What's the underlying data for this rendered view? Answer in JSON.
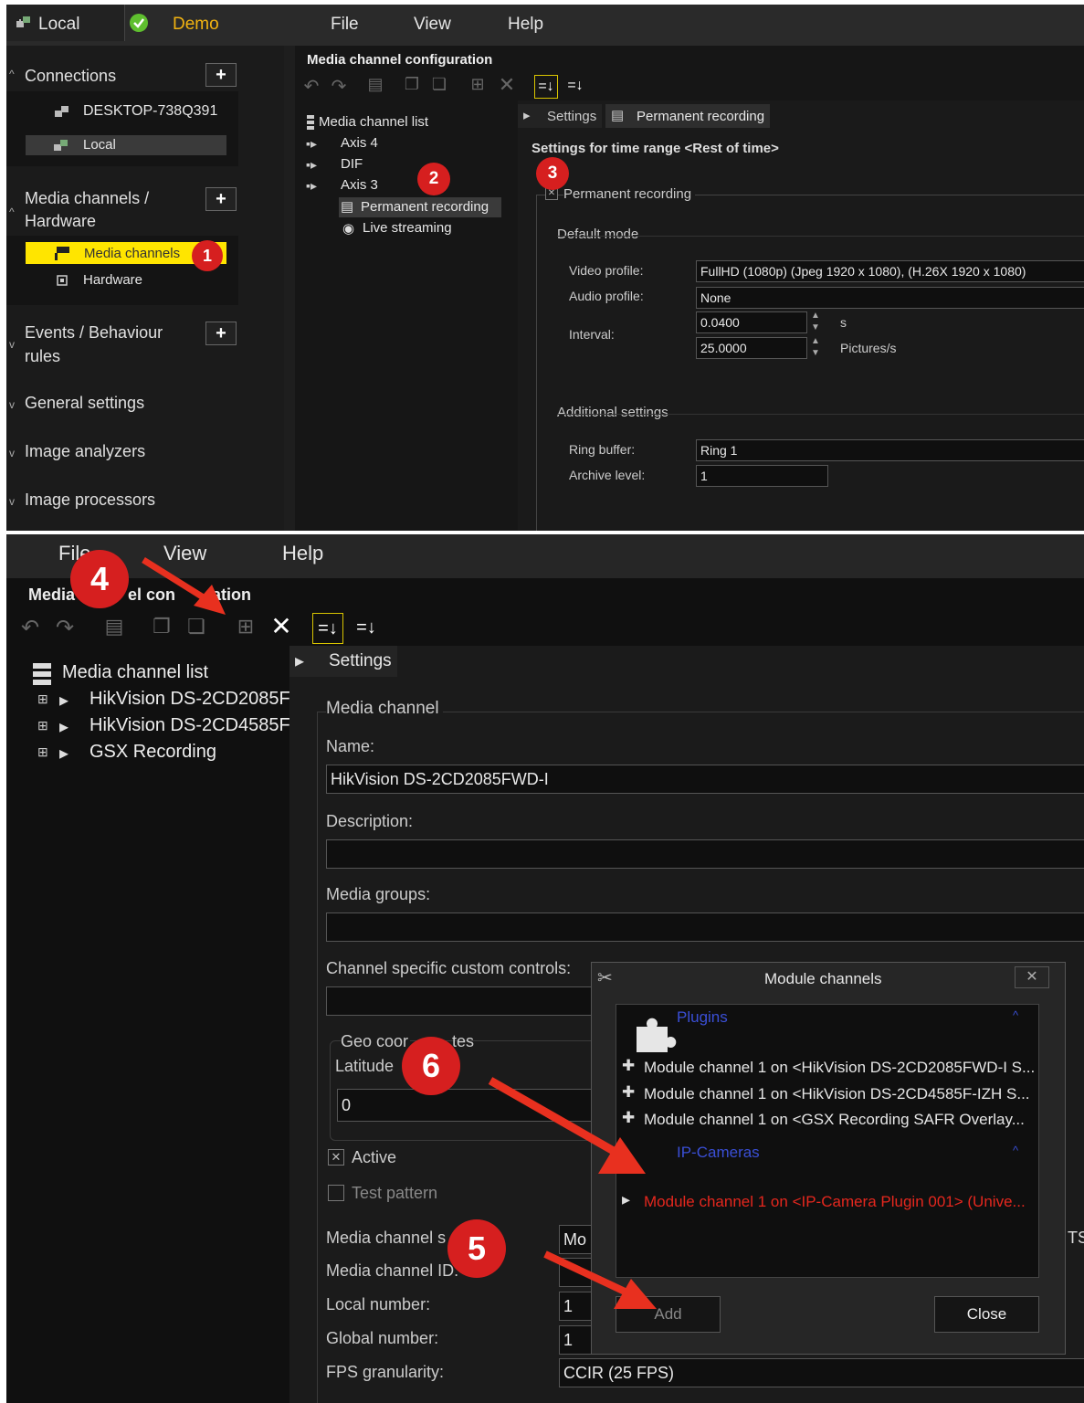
{
  "top": {
    "menubar": {
      "local_label": "Local",
      "demo_label": "Demo",
      "menu": [
        "File",
        "View",
        "Help"
      ]
    },
    "sidebar": {
      "connections": {
        "title": "Connections",
        "items": [
          "DESKTOP-738Q391",
          "Local"
        ]
      },
      "media_channels_hw": {
        "title_line1": "Media channels /",
        "title_line2": "Hardware",
        "items": [
          "Media channels",
          "Hardware"
        ]
      },
      "events": {
        "title_line1": "Events / Behaviour",
        "title_line2": "rules"
      },
      "general": "General settings",
      "analyzers": "Image analyzers",
      "processors": "Image processors"
    },
    "config_title": "Media channel configuration",
    "tree": {
      "root": "Media channel list",
      "items": [
        "Axis 4",
        "DIF",
        "Axis 3"
      ],
      "children": [
        "Permanent recording",
        "Live streaming"
      ]
    },
    "tabs": [
      "Settings",
      "Permanent recording"
    ],
    "settings_header": "Settings for time range <Rest of time>",
    "permanent_recording_check": "Permanent recording",
    "check_mark": "✕",
    "default_mode": "Default mode",
    "video_profile_label": "Video profile:",
    "video_profile_value": "FullHD (1080p) (Jpeg 1920 x 1080), (H.26X 1920 x 1080)",
    "audio_profile_label": "Audio profile:",
    "audio_profile_value": "None",
    "interval_label": "Interval:",
    "interval_value": "0.0400",
    "interval_unit": "s",
    "pictures_value": "25.0000",
    "pictures_unit": "Pictures/s",
    "additional_settings": "Additional settings",
    "ring_buffer_label": "Ring buffer:",
    "ring_buffer_value": "Ring 1",
    "archive_level_label": "Archive level:",
    "archive_level_value": "1",
    "badges": [
      "1",
      "2",
      "3"
    ]
  },
  "bottom": {
    "menu": [
      "File",
      "View",
      "Help"
    ],
    "config_title_left": "Media",
    "config_title_mid": "el con",
    "config_title_right": "ation",
    "tree": {
      "root": "Media channel list",
      "items": [
        "HikVision DS-2CD2085F",
        "HikVision DS-2CD4585F",
        "GSX Recording"
      ]
    },
    "tab": "Settings",
    "media_channel_group": "Media channel",
    "name_label": "Name:",
    "name_value": "HikVision DS-2CD2085FWD-I",
    "description_label": "Description:",
    "media_groups_label": "Media groups:",
    "custom_controls_label": "Channel specific custom controls:",
    "geo_label_a": "Geo coor",
    "geo_label_b": "tes",
    "latitude_label": "Latitude",
    "latitude_value": "0",
    "active_label": "Active",
    "test_pattern_label": "Test pattern",
    "check_mark": "✕",
    "media_channel_s_label": "Media channel s",
    "media_channel_id_label": "Media channel ID:",
    "local_number_label": "Local number:",
    "local_number_value": "1",
    "global_number_label": "Global number:",
    "global_number_value": "1",
    "fps_label": "FPS granularity:",
    "fps_value": "CCIR (25 FPS)",
    "mo_value": "Mo",
    "ts_value": "TS",
    "dialog": {
      "title": "Module channels",
      "close_x": "✕",
      "plugins_header": "Plugins",
      "plugin_items": [
        "Module channel 1 on <HikVision DS-2CD2085FWD-I S...",
        "Module channel 1 on <HikVision DS-2CD4585F-IZH S...",
        "Module channel 1 on <GSX Recording SAFR Overlay..."
      ],
      "ipcam_header": "IP-Cameras",
      "ipcam_item": "Module channel 1 on <IP-Camera Plugin 001> (Unive...",
      "add_button": "Add",
      "close_button": "Close"
    },
    "badges": [
      "4",
      "5",
      "6"
    ]
  },
  "colors": {
    "yellow_highlight": "#ffe500",
    "badge_red": "#d61f1f",
    "demo_orange": "#f2b311",
    "ok_green": "#5fbf2f",
    "link_blue": "#3a4fd6",
    "ipcam_red": "#e5271e",
    "arrow_red": "#e8301f"
  }
}
